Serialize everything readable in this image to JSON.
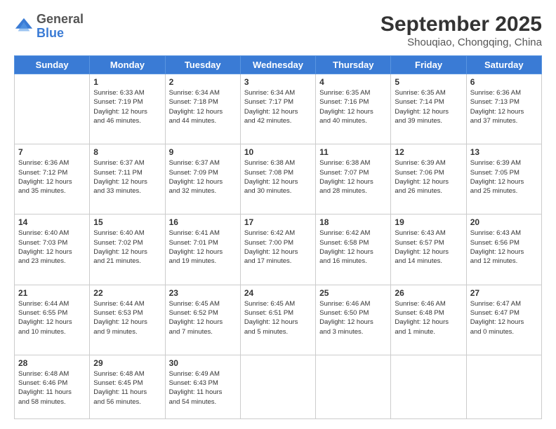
{
  "header": {
    "logo_general": "General",
    "logo_blue": "Blue",
    "title": "September 2025",
    "location": "Shouqiao, Chongqing, China"
  },
  "weekdays": [
    "Sunday",
    "Monday",
    "Tuesday",
    "Wednesday",
    "Thursday",
    "Friday",
    "Saturday"
  ],
  "weeks": [
    [
      {
        "day": "",
        "content": ""
      },
      {
        "day": "1",
        "content": "Sunrise: 6:33 AM\nSunset: 7:19 PM\nDaylight: 12 hours\nand 46 minutes."
      },
      {
        "day": "2",
        "content": "Sunrise: 6:34 AM\nSunset: 7:18 PM\nDaylight: 12 hours\nand 44 minutes."
      },
      {
        "day": "3",
        "content": "Sunrise: 6:34 AM\nSunset: 7:17 PM\nDaylight: 12 hours\nand 42 minutes."
      },
      {
        "day": "4",
        "content": "Sunrise: 6:35 AM\nSunset: 7:16 PM\nDaylight: 12 hours\nand 40 minutes."
      },
      {
        "day": "5",
        "content": "Sunrise: 6:35 AM\nSunset: 7:14 PM\nDaylight: 12 hours\nand 39 minutes."
      },
      {
        "day": "6",
        "content": "Sunrise: 6:36 AM\nSunset: 7:13 PM\nDaylight: 12 hours\nand 37 minutes."
      }
    ],
    [
      {
        "day": "7",
        "content": "Sunrise: 6:36 AM\nSunset: 7:12 PM\nDaylight: 12 hours\nand 35 minutes."
      },
      {
        "day": "8",
        "content": "Sunrise: 6:37 AM\nSunset: 7:11 PM\nDaylight: 12 hours\nand 33 minutes."
      },
      {
        "day": "9",
        "content": "Sunrise: 6:37 AM\nSunset: 7:09 PM\nDaylight: 12 hours\nand 32 minutes."
      },
      {
        "day": "10",
        "content": "Sunrise: 6:38 AM\nSunset: 7:08 PM\nDaylight: 12 hours\nand 30 minutes."
      },
      {
        "day": "11",
        "content": "Sunrise: 6:38 AM\nSunset: 7:07 PM\nDaylight: 12 hours\nand 28 minutes."
      },
      {
        "day": "12",
        "content": "Sunrise: 6:39 AM\nSunset: 7:06 PM\nDaylight: 12 hours\nand 26 minutes."
      },
      {
        "day": "13",
        "content": "Sunrise: 6:39 AM\nSunset: 7:05 PM\nDaylight: 12 hours\nand 25 minutes."
      }
    ],
    [
      {
        "day": "14",
        "content": "Sunrise: 6:40 AM\nSunset: 7:03 PM\nDaylight: 12 hours\nand 23 minutes."
      },
      {
        "day": "15",
        "content": "Sunrise: 6:40 AM\nSunset: 7:02 PM\nDaylight: 12 hours\nand 21 minutes."
      },
      {
        "day": "16",
        "content": "Sunrise: 6:41 AM\nSunset: 7:01 PM\nDaylight: 12 hours\nand 19 minutes."
      },
      {
        "day": "17",
        "content": "Sunrise: 6:42 AM\nSunset: 7:00 PM\nDaylight: 12 hours\nand 17 minutes."
      },
      {
        "day": "18",
        "content": "Sunrise: 6:42 AM\nSunset: 6:58 PM\nDaylight: 12 hours\nand 16 minutes."
      },
      {
        "day": "19",
        "content": "Sunrise: 6:43 AM\nSunset: 6:57 PM\nDaylight: 12 hours\nand 14 minutes."
      },
      {
        "day": "20",
        "content": "Sunrise: 6:43 AM\nSunset: 6:56 PM\nDaylight: 12 hours\nand 12 minutes."
      }
    ],
    [
      {
        "day": "21",
        "content": "Sunrise: 6:44 AM\nSunset: 6:55 PM\nDaylight: 12 hours\nand 10 minutes."
      },
      {
        "day": "22",
        "content": "Sunrise: 6:44 AM\nSunset: 6:53 PM\nDaylight: 12 hours\nand 9 minutes."
      },
      {
        "day": "23",
        "content": "Sunrise: 6:45 AM\nSunset: 6:52 PM\nDaylight: 12 hours\nand 7 minutes."
      },
      {
        "day": "24",
        "content": "Sunrise: 6:45 AM\nSunset: 6:51 PM\nDaylight: 12 hours\nand 5 minutes."
      },
      {
        "day": "25",
        "content": "Sunrise: 6:46 AM\nSunset: 6:50 PM\nDaylight: 12 hours\nand 3 minutes."
      },
      {
        "day": "26",
        "content": "Sunrise: 6:46 AM\nSunset: 6:48 PM\nDaylight: 12 hours\nand 1 minute."
      },
      {
        "day": "27",
        "content": "Sunrise: 6:47 AM\nSunset: 6:47 PM\nDaylight: 12 hours\nand 0 minutes."
      }
    ],
    [
      {
        "day": "28",
        "content": "Sunrise: 6:48 AM\nSunset: 6:46 PM\nDaylight: 11 hours\nand 58 minutes."
      },
      {
        "day": "29",
        "content": "Sunrise: 6:48 AM\nSunset: 6:45 PM\nDaylight: 11 hours\nand 56 minutes."
      },
      {
        "day": "30",
        "content": "Sunrise: 6:49 AM\nSunset: 6:43 PM\nDaylight: 11 hours\nand 54 minutes."
      },
      {
        "day": "",
        "content": ""
      },
      {
        "day": "",
        "content": ""
      },
      {
        "day": "",
        "content": ""
      },
      {
        "day": "",
        "content": ""
      }
    ]
  ]
}
